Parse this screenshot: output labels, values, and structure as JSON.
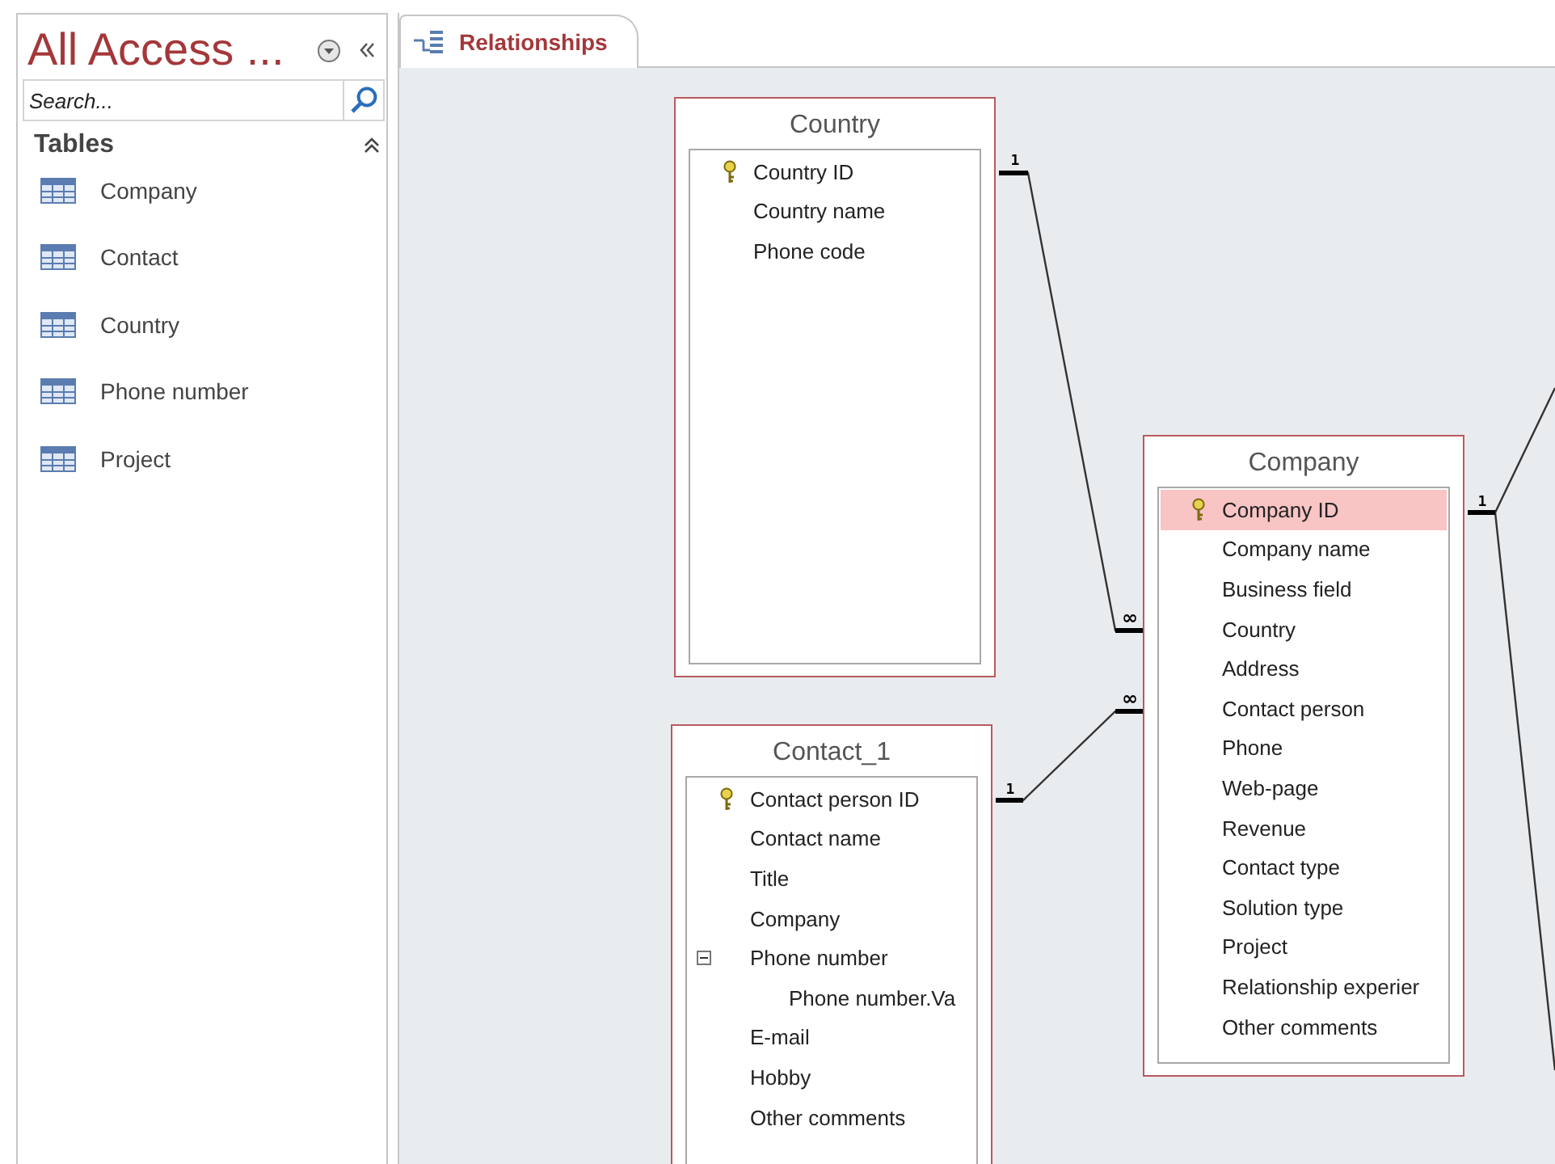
{
  "nav_pane": {
    "title": "All Access ...",
    "search": {
      "placeholder": "Search..."
    },
    "group": {
      "label": "Tables",
      "expanded": true
    },
    "items": [
      {
        "label": "Company"
      },
      {
        "label": "Contact"
      },
      {
        "label": "Country"
      },
      {
        "label": "Phone number"
      },
      {
        "label": "Project"
      }
    ]
  },
  "tabs": [
    {
      "label": "Relationships",
      "selected": true
    }
  ],
  "tables": [
    {
      "title": "Country",
      "fields": [
        {
          "name": "Country ID",
          "primary_key": true,
          "selected": false
        },
        {
          "name": "Country name",
          "primary_key": false,
          "selected": false
        },
        {
          "name": "Phone code",
          "primary_key": false,
          "selected": false
        }
      ]
    },
    {
      "title": "Company",
      "fields": [
        {
          "name": "Company ID",
          "primary_key": true,
          "selected": true
        },
        {
          "name": "Company name",
          "primary_key": false,
          "selected": false
        },
        {
          "name": "Business field",
          "primary_key": false,
          "selected": false
        },
        {
          "name": "Country",
          "primary_key": false,
          "selected": false
        },
        {
          "name": "Address",
          "primary_key": false,
          "selected": false
        },
        {
          "name": "Contact person",
          "primary_key": false,
          "selected": false
        },
        {
          "name": "Phone",
          "primary_key": false,
          "selected": false
        },
        {
          "name": "Web-page",
          "primary_key": false,
          "selected": false
        },
        {
          "name": "Revenue",
          "primary_key": false,
          "selected": false
        },
        {
          "name": "Contact type",
          "primary_key": false,
          "selected": false
        },
        {
          "name": "Solution type",
          "primary_key": false,
          "selected": false
        },
        {
          "name": "Project",
          "primary_key": false,
          "selected": false
        },
        {
          "name": "Relationship experier",
          "primary_key": false,
          "selected": false
        },
        {
          "name": "Other comments",
          "primary_key": false,
          "selected": false
        }
      ]
    },
    {
      "title": "Contact_1",
      "fields": [
        {
          "name": "Contact person ID",
          "primary_key": true,
          "selected": false
        },
        {
          "name": "Contact name",
          "primary_key": false,
          "selected": false
        },
        {
          "name": "Title",
          "primary_key": false,
          "selected": false
        },
        {
          "name": "Company",
          "primary_key": false,
          "selected": false
        },
        {
          "name": "Phone number",
          "primary_key": false,
          "selected": false,
          "expanded": true,
          "children": [
            {
              "name": "Phone number.Va",
              "primary_key": false,
              "selected": false
            }
          ]
        },
        {
          "name": "E-mail",
          "primary_key": false,
          "selected": false
        },
        {
          "name": "Hobby",
          "primary_key": false,
          "selected": false
        },
        {
          "name": "Other comments",
          "primary_key": false,
          "selected": false
        }
      ]
    }
  ],
  "relationships": [
    {
      "one_label": "1",
      "many_label": "∞"
    },
    {
      "one_label": "1",
      "many_label": "∞"
    },
    {
      "one_label": "1"
    }
  ]
}
